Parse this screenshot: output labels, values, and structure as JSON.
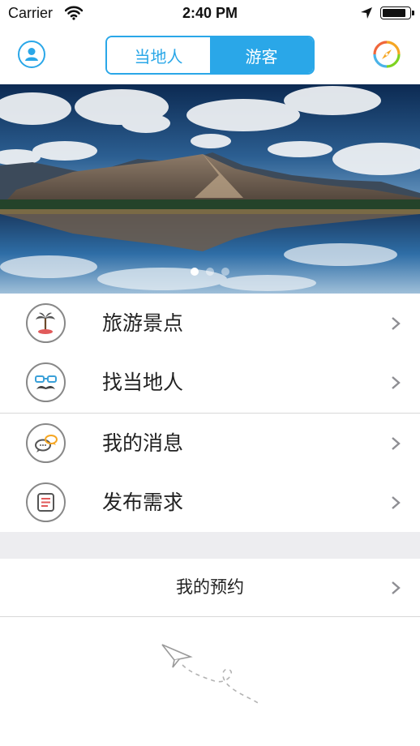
{
  "status_bar": {
    "carrier": "Carrier",
    "time": "2:40 PM",
    "battery_level": 0.9
  },
  "nav": {
    "profile_icon": "user-icon",
    "segments": [
      {
        "label": "当地人",
        "selected": false
      },
      {
        "label": "游客",
        "selected": true
      }
    ],
    "compass_icon": "compass-icon"
  },
  "banner": {
    "page_count": 3,
    "current_page": 1,
    "image": "mountain-lake-landscape"
  },
  "menu": [
    {
      "label": "旅游景点",
      "icon": "palm-island-icon"
    },
    {
      "label": "找当地人",
      "icon": "glasses-mustache-icon"
    },
    {
      "label": "我的消息",
      "icon": "chat-bubbles-icon"
    },
    {
      "label": "发布需求",
      "icon": "document-list-icon"
    }
  ],
  "reservation": {
    "label": "我的预约"
  },
  "colors": {
    "accent": "#2aa7e8",
    "band": "#ededf0",
    "separator": "#d8d8d8"
  }
}
